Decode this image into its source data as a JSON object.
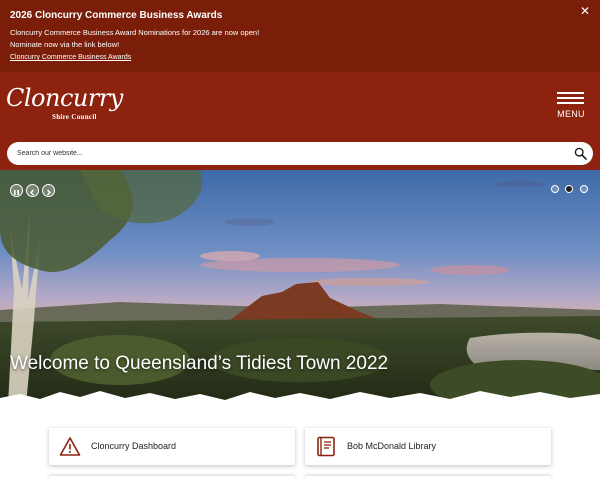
{
  "alert": {
    "title": "2026 Cloncurry Commerce Business Awards",
    "line1": "Cloncurry Commerce Business Award Nominations for 2026 are now open!",
    "line2": "Nominate now via the link below!",
    "link": "Cloncurry Commerce Business Awards",
    "close_icon": "close-icon"
  },
  "header": {
    "logo_script": "Cloncurry",
    "logo_sub": "Shire Council",
    "menu_label": "MENU",
    "menu_icon": "hamburger-icon"
  },
  "search": {
    "placeholder": "Search our website...",
    "icon": "search-icon"
  },
  "hero": {
    "title": "Welcome to Queensland’s Tidiest Town 2022",
    "controls": [
      "pause-icon",
      "prev-icon",
      "next-icon"
    ],
    "slide_count": 3,
    "active_slide": 2
  },
  "quick_links": [
    {
      "label": "Cloncurry Dashboard",
      "icon": "warning-icon"
    },
    {
      "label": "Bob McDonald Library",
      "icon": "book-icon"
    }
  ],
  "colors": {
    "alert_bg": "#7a1e0a",
    "header_bg": "#8d230f",
    "accent": "#8d230f"
  }
}
